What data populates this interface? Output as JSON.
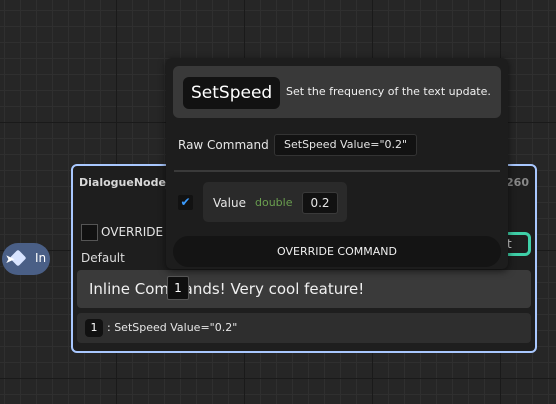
{
  "in_pin": {
    "label": "In",
    "icon": "exec-diamond-icon"
  },
  "node": {
    "title": "DialogueNode_",
    "id": "260",
    "override_label": "OVERRIDE",
    "default_label": "Default",
    "output_pin_label": "t",
    "inline_text": "Inline Commands! Very cool feature!",
    "command_index": "1",
    "command_text": ": SetSpeed Value=\"0.2\""
  },
  "popup": {
    "command_name": "SetSpeed",
    "description": "Set the frequency of the text update.",
    "raw_command_label": "Raw Command",
    "raw_command_value": "SetSpeed Value=\"0.2\"",
    "param": {
      "checked": true,
      "name": "Value",
      "type": "double",
      "value": "0.2"
    },
    "override_button": "OVERRIDE COMMAND"
  },
  "marker_index": "1",
  "colors": {
    "accent_border": "#a9c8ff",
    "output_pin": "#3fd0a8",
    "checkbox": "#3b9cff",
    "type_color": "#6a9f4f"
  }
}
